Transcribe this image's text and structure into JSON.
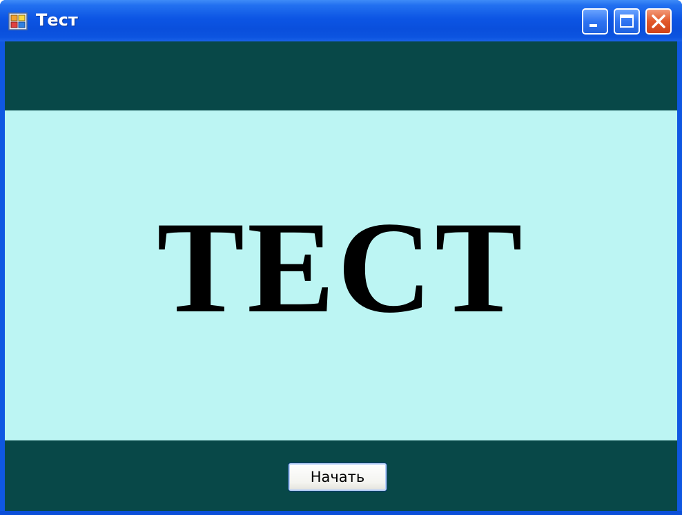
{
  "window": {
    "title": "Тест",
    "controls": {
      "minimize": "minimize-icon",
      "maximize": "maximize-icon",
      "close": "close-icon"
    }
  },
  "main": {
    "banner_text": "ТЕСТ"
  },
  "footer": {
    "start_label": "Начать"
  },
  "colors": {
    "titlebar": "#0c55e4",
    "client_background": "#084848",
    "banner_background": "#bcf5f3",
    "banner_text": "#000000",
    "close_button": "#e2582b"
  }
}
